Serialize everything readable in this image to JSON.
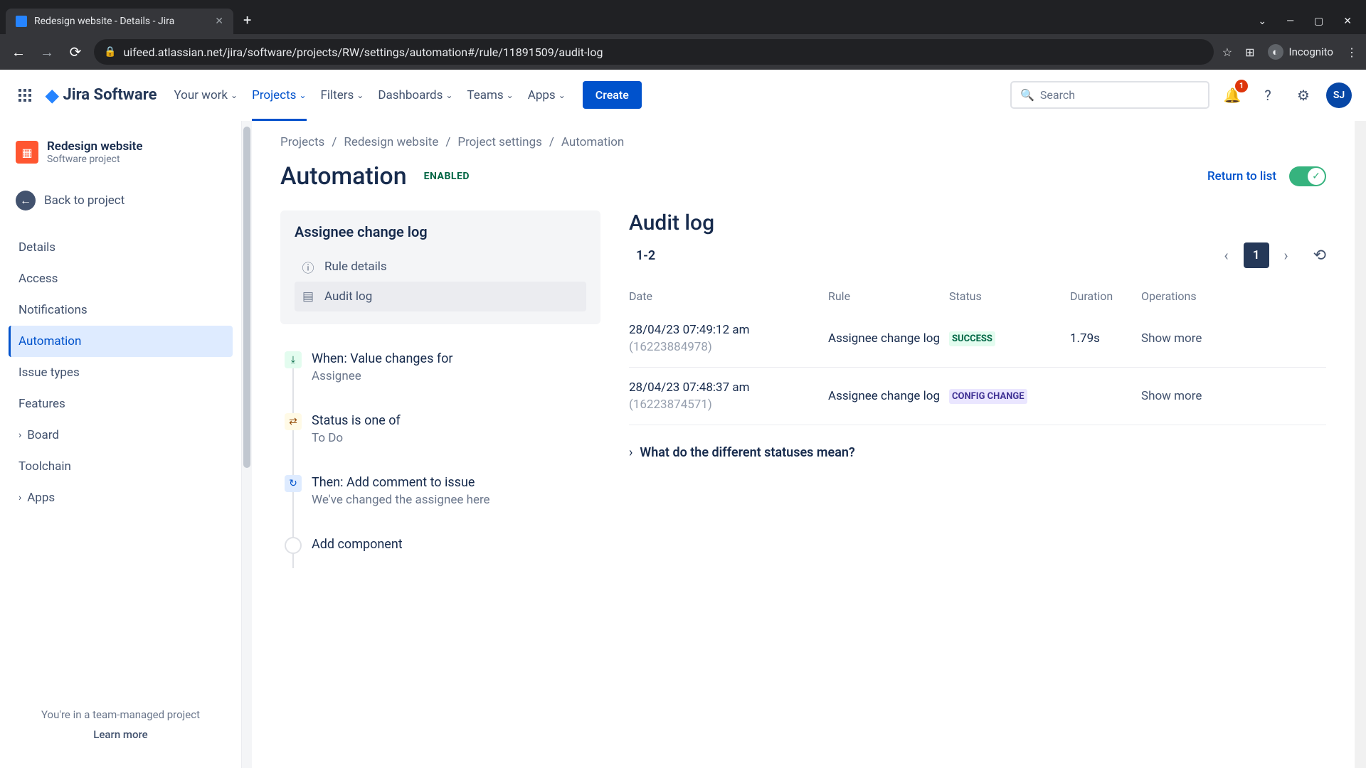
{
  "browser": {
    "tab_title": "Redesign website - Details - Jira",
    "url": "uifeed.atlassian.net/jira/software/projects/RW/settings/automation#/rule/11891509/audit-log",
    "incognito_label": "Incognito"
  },
  "topnav": {
    "logo": "Jira Software",
    "items": [
      "Your work",
      "Projects",
      "Filters",
      "Dashboards",
      "Teams",
      "Apps"
    ],
    "active_index": 1,
    "create": "Create",
    "search_placeholder": "Search",
    "notif_count": "1",
    "avatar_initials": "SJ"
  },
  "sidebar": {
    "project_name": "Redesign website",
    "project_type": "Software project",
    "back_label": "Back to project",
    "items": [
      "Details",
      "Access",
      "Notifications",
      "Automation",
      "Issue types",
      "Features",
      "Board",
      "Toolchain",
      "Apps"
    ],
    "active_index": 3,
    "expandable": [
      6,
      8
    ],
    "footer_line1": "You're in a team-managed project",
    "footer_line2": "Learn more"
  },
  "breadcrumb": [
    "Projects",
    "Redesign website",
    "Project settings",
    "Automation"
  ],
  "header": {
    "title": "Automation",
    "status": "ENABLED",
    "return": "Return to list"
  },
  "rule": {
    "name": "Assignee change log",
    "nav": [
      {
        "label": "Rule details",
        "selected": false
      },
      {
        "label": "Audit log",
        "selected": true
      }
    ],
    "steps": [
      {
        "kind": "trigger",
        "title": "When: Value changes for",
        "sub": "Assignee"
      },
      {
        "kind": "cond",
        "title": "Status is one of",
        "sub": "To Do"
      },
      {
        "kind": "act",
        "title": "Then: Add comment to issue",
        "sub": "We've changed the assignee here"
      },
      {
        "kind": "add",
        "title": "Add component",
        "sub": ""
      }
    ]
  },
  "audit": {
    "title": "Audit log",
    "range_from": "1",
    "range_to": "2",
    "current_page": "1",
    "columns": [
      "Date",
      "Rule",
      "Status",
      "Duration",
      "Operations"
    ],
    "rows": [
      {
        "ts": "28/04/23 07:49:12 am",
        "id": "(16223884978)",
        "rule": "Assignee change log",
        "status": "SUCCESS",
        "status_class": "status-success",
        "duration": "1.79s",
        "op": "Show more"
      },
      {
        "ts": "28/04/23 07:48:37 am",
        "id": "(16223874571)",
        "rule": "Assignee change log",
        "status": "CONFIG CHANGE",
        "status_class": "status-config",
        "duration": "",
        "op": "Show more"
      }
    ],
    "disclosure": "What do the different statuses mean?"
  }
}
